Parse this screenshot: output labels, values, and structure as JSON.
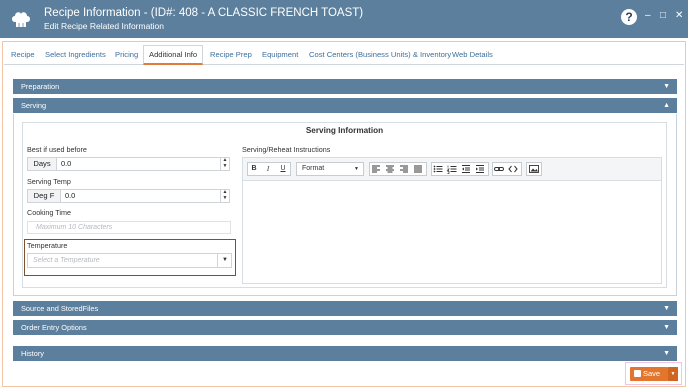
{
  "window": {
    "title": "Recipe Information - (ID#: 408 - A CLASSIC FRENCH TOAST)",
    "subtitle": "Edit Recipe Related Information",
    "help_label": "?",
    "minimize_label": "–",
    "maximize_label": "□",
    "close_label": "✕"
  },
  "tabs": [
    {
      "label": "Recipe"
    },
    {
      "label": "Select Ingredients"
    },
    {
      "label": "Pricing"
    },
    {
      "label": "Additional Info",
      "active": true
    },
    {
      "label": "Recipe Prep"
    },
    {
      "label": "Equipment"
    },
    {
      "label": "Cost Centers (Business Units) & Inventory"
    },
    {
      "label": "Web Details"
    }
  ],
  "sections": {
    "preparation": {
      "label": "Preparation",
      "chevron": "chevron-down-icon"
    },
    "serving": {
      "label": "Serving",
      "chevron": "chevron-up-icon"
    },
    "source": {
      "label": "Source and StoredFiles",
      "chevron": "chevron-down-icon"
    },
    "order_entry": {
      "label": "Order Entry Options",
      "chevron": "chevron-down-icon"
    },
    "history": {
      "label": "History",
      "chevron": "chevron-down-icon"
    }
  },
  "serving": {
    "heading": "Serving Information",
    "best_if_used": {
      "label": "Best if used before",
      "unit": "Days",
      "value": "0.0"
    },
    "serving_temp": {
      "label": "Serving Temp",
      "unit": "Deg F",
      "value": "0.0"
    },
    "cooking_time": {
      "label": "Cooking Time",
      "placeholder": "Maximum 10 Characters"
    },
    "temperature": {
      "label": "Temperature",
      "placeholder": "Select a Temperature"
    },
    "instructions": {
      "label": "Serving/Reheat Instructions",
      "format_label": "Format"
    }
  },
  "editor_toolbar": [
    "bold",
    "italic",
    "underline",
    "format",
    "align-left",
    "align-center",
    "align-right",
    "justify",
    "bullet-list",
    "numbered-list",
    "outdent",
    "indent",
    "link",
    "code",
    "image"
  ],
  "footer": {
    "save_label": "Save"
  },
  "colors": {
    "header": "#5b7f9c",
    "accent": "#e2762e",
    "highlight": "#7a5230"
  }
}
